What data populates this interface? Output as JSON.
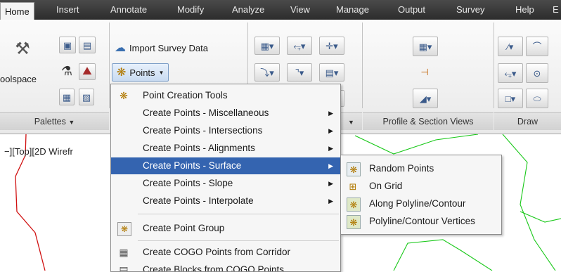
{
  "tabs": [
    "Home",
    "Insert",
    "Annotate",
    "Modify",
    "Analyze",
    "View",
    "Manage",
    "Output",
    "Survey",
    "Help",
    "E"
  ],
  "ribbon": {
    "toolspace_label": "oolspace",
    "import_survey_label": "Import Survey Data",
    "points_label": "Points",
    "panels": {
      "palettes": "Palettes",
      "profile_section": "Profile & Section Views",
      "draw": "Draw"
    }
  },
  "viewport_label": "−][Top][2D Wirefr",
  "points_menu": {
    "items": [
      {
        "label": "Point Creation Tools",
        "icon": "point-creation-icon",
        "submenu": false
      },
      {
        "label": "Create Points - Miscellaneous",
        "submenu": true
      },
      {
        "label": "Create Points - Intersections",
        "submenu": true
      },
      {
        "label": "Create Points - Alignments",
        "submenu": true
      },
      {
        "label": "Create Points - Surface",
        "submenu": true,
        "highlighted": true
      },
      {
        "label": "Create Points - Slope",
        "submenu": true
      },
      {
        "label": "Create Points - Interpolate",
        "submenu": true
      },
      {
        "label": "Create Point Group",
        "icon": "point-group-icon",
        "submenu": false
      },
      {
        "label": "Create COGO Points from Corridor",
        "icon": "corridor-points-icon",
        "submenu": false
      },
      {
        "label": "Create Blocks from COGO Points",
        "icon": "blocks-icon",
        "submenu": false
      }
    ]
  },
  "surface_submenu": {
    "items": [
      {
        "label": "Random Points",
        "icon": "random-points-icon"
      },
      {
        "label": "On Grid",
        "icon": "grid-points-icon"
      },
      {
        "label": "Along Polyline/Contour",
        "icon": "polyline-points-icon"
      },
      {
        "label": "Polyline/Contour Vertices",
        "icon": "vertices-points-icon"
      }
    ]
  },
  "colors": {
    "highlight": "#3464b0",
    "tabbar": "#333333",
    "polyline_red": "#d01010",
    "polyline_green": "#18c818"
  }
}
